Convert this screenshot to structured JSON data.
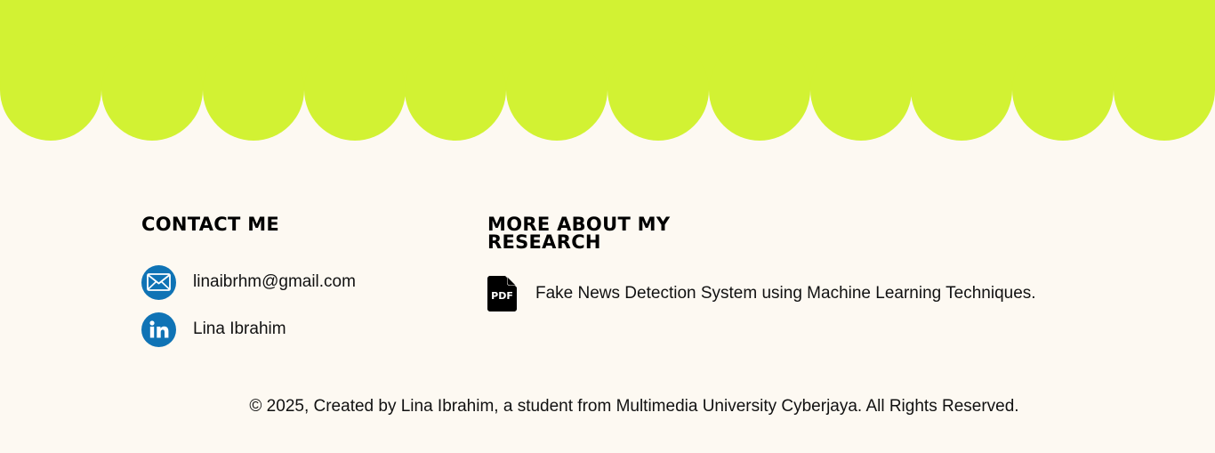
{
  "theme": {
    "accent_color": "#d2f233",
    "background_color": "#fdf9f2",
    "icon_blue": "#0f73b5",
    "text_color": "#111111"
  },
  "contact": {
    "heading": "CONTACT ME",
    "email": {
      "icon": "mail-icon",
      "label": "linaibrhm@gmail.com"
    },
    "linkedin": {
      "icon": "linkedin-icon",
      "label": "Lina Ibrahim"
    }
  },
  "research": {
    "heading": "MORE ABOUT MY RESEARCH",
    "items": [
      {
        "icon": "pdf-file-icon",
        "icon_text": "PDF",
        "label": "Fake News Detection System using Machine Learning Techniques."
      }
    ]
  },
  "footer": {
    "copyright": "© 2025, Created by Lina Ibrahim, a student from Multimedia University Cyberjaya.  All Rights Reserved."
  }
}
